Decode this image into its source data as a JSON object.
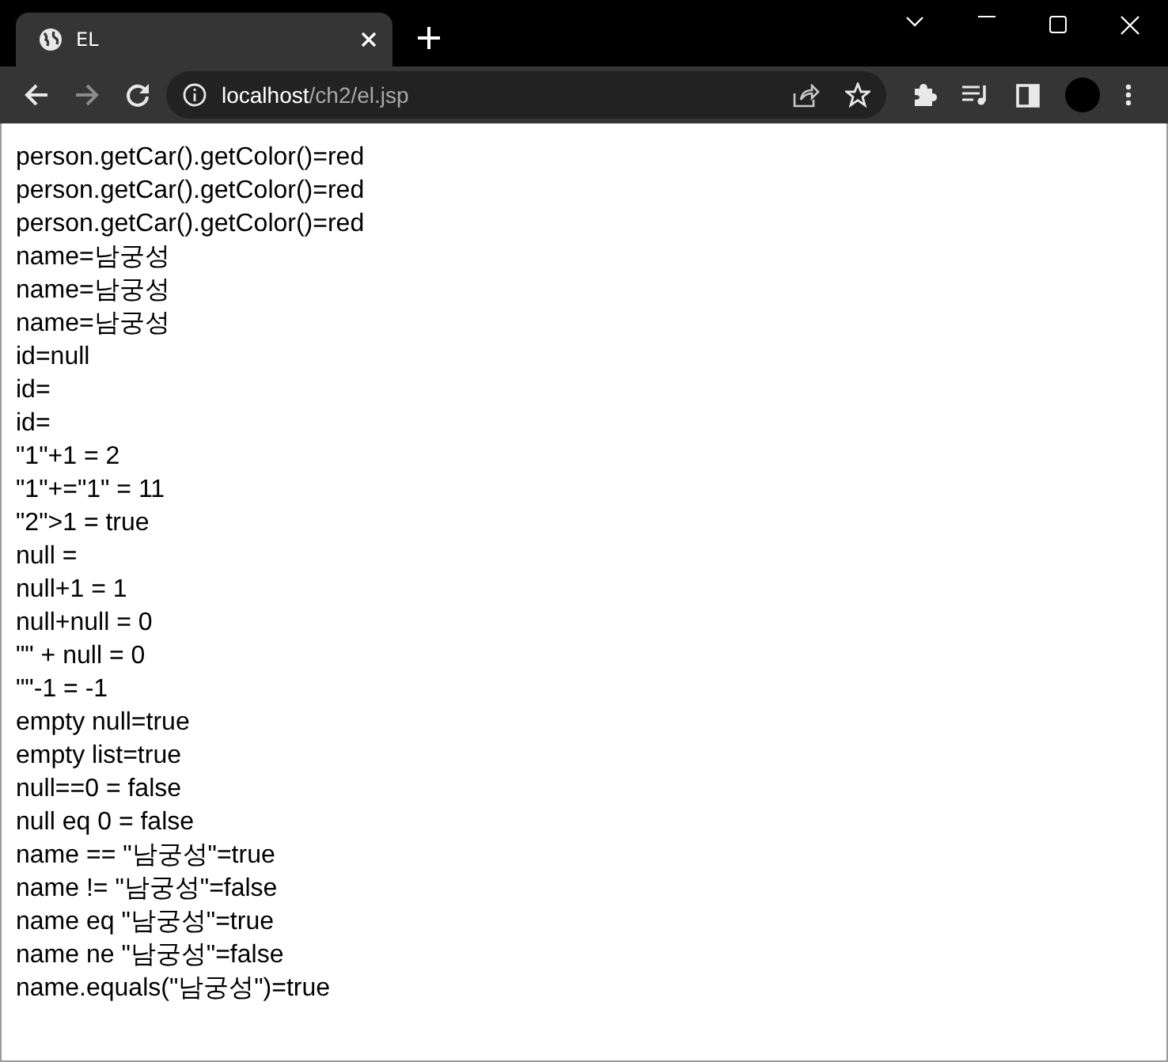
{
  "tab": {
    "title": "EL"
  },
  "toolbar": {
    "forward": {
      "disabled": true
    }
  },
  "address": {
    "host": "localhost",
    "path": "/ch2/el.jsp"
  },
  "lines": [
    "person.getCar().getColor()=red",
    "person.getCar().getColor()=red",
    "person.getCar().getColor()=red",
    "name=남궁성",
    "name=남궁성",
    "name=남궁성",
    "id=null",
    "id=",
    "id=",
    "\"1\"+1 = 2",
    "\"1\"+=\"1\" = 11",
    "\"2\">1 = true",
    "null =",
    "null+1 = 1",
    "null+null = 0",
    "\"\" + null = 0",
    "\"\"-1 = -1",
    "empty null=true",
    "empty list=true",
    "null==0 = false",
    "null eq 0 = false",
    "name == \"남궁성\"=true",
    "name != \"남궁성\"=false",
    "name eq \"남궁성\"=true",
    "name ne \"남궁성\"=false",
    "name.equals(\"남궁성\")=true"
  ]
}
